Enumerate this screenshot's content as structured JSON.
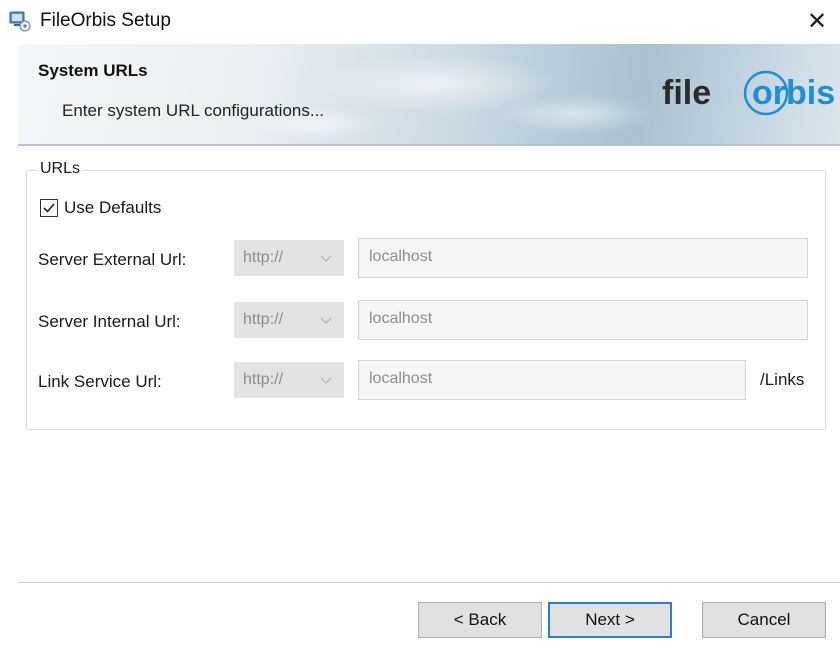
{
  "window": {
    "title": "FileOrbis Setup"
  },
  "icons": {
    "app": "setup-app-icon",
    "close": "close-icon",
    "dropdown": "chevron-down-icon",
    "check": "checkmark-icon"
  },
  "banner": {
    "title": "System URLs",
    "subtitle": "Enter system URL configurations...",
    "logo_text": "fileorbis",
    "logo_prefix": "file",
    "logo_suffix": "orbis",
    "accent": "#1e8fd0"
  },
  "group": {
    "label": "URLs",
    "use_defaults": {
      "label": "Use Defaults",
      "checked": true
    },
    "rows": [
      {
        "label": "Server External Url:",
        "protocol": "http://",
        "value": "localhost",
        "suffix": ""
      },
      {
        "label": "Server Internal Url:",
        "protocol": "http://",
        "value": "localhost",
        "suffix": ""
      },
      {
        "label": "Link Service Url:",
        "protocol": "http://",
        "value": "localhost",
        "suffix": "/Links"
      }
    ]
  },
  "buttons": {
    "back": "< Back",
    "next": "Next >",
    "cancel": "Cancel"
  }
}
